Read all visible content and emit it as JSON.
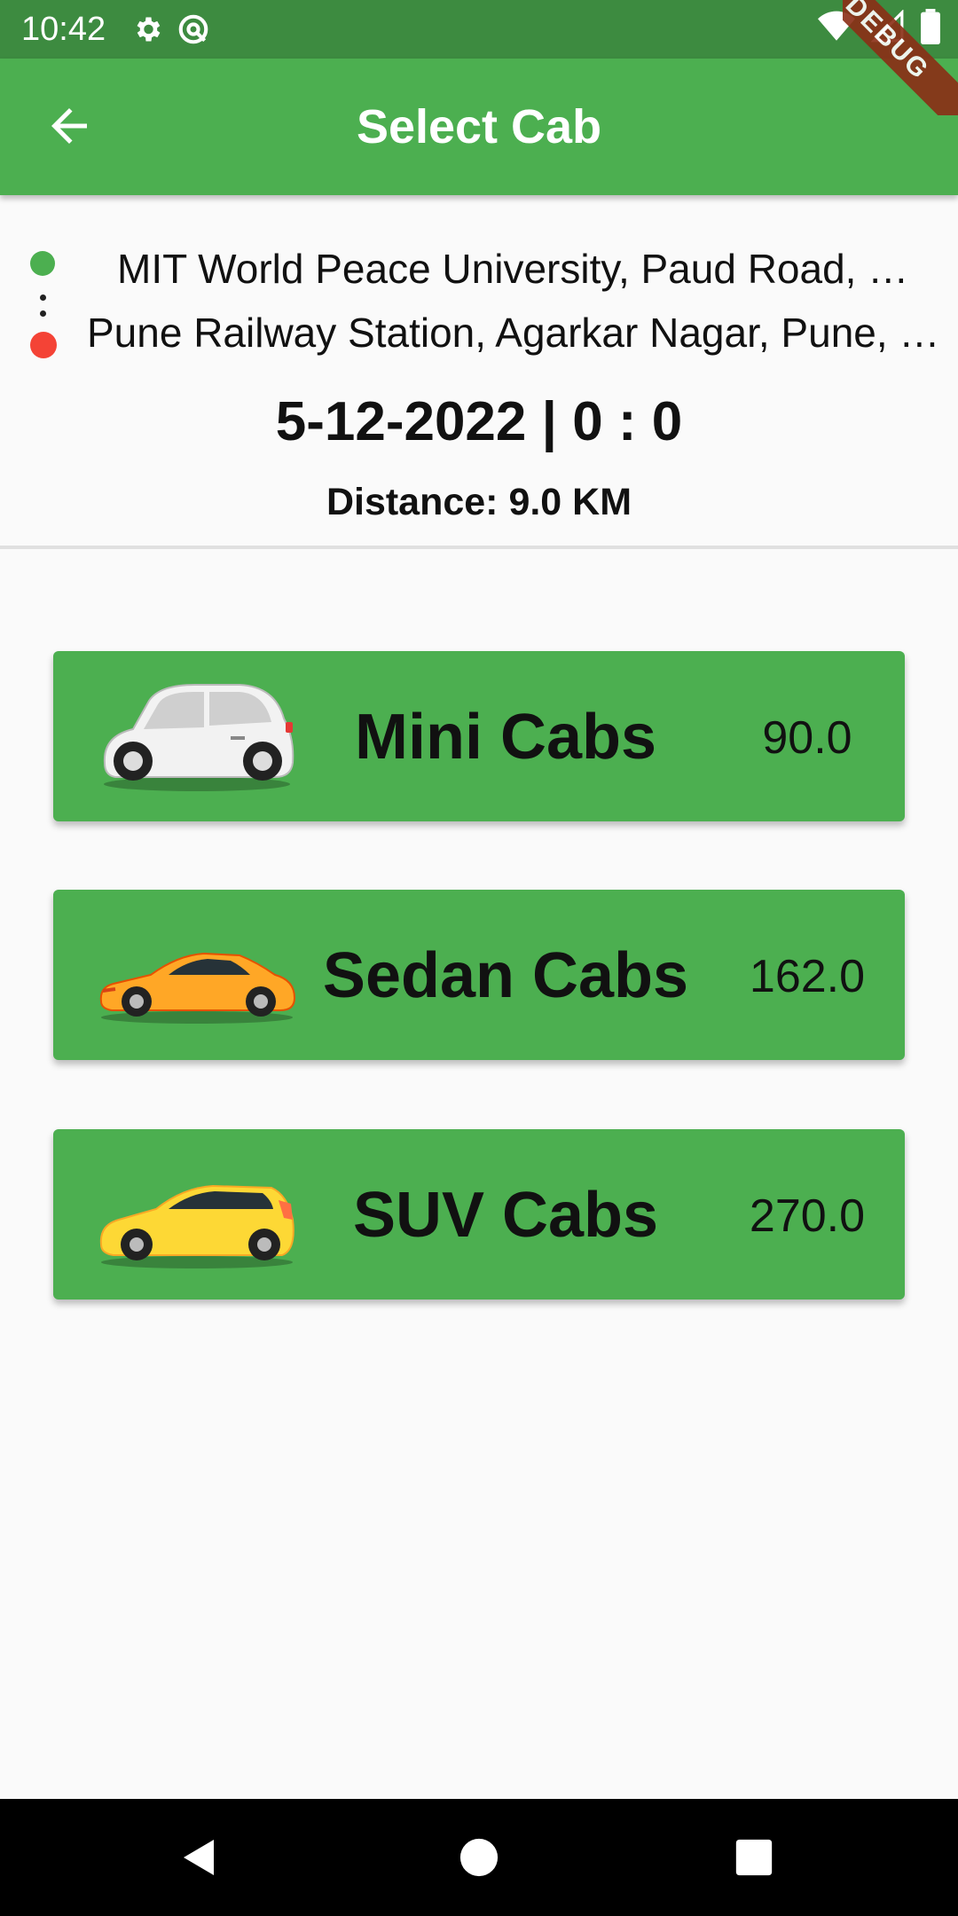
{
  "status_bar": {
    "time": "10:42",
    "icons": [
      "settings-icon",
      "sync-icon",
      "wifi-icon",
      "signal-icon",
      "battery-icon"
    ]
  },
  "debug_banner": "DEBUG",
  "app_bar": {
    "title": "Select Cab",
    "back_icon": "arrow-back-icon"
  },
  "route": {
    "origin": "MIT World Peace University, Paud Road, Kothrud, Pune",
    "destination": "Pune Railway Station, Agarkar Nagar, Pune, Maharashtra"
  },
  "trip": {
    "datetime": "5-12-2022 | 0 : 0",
    "distance": "Distance: 9.0 KM"
  },
  "cabs": [
    {
      "name": "Mini Cabs",
      "price": "90.0",
      "icon": "white-car-icon"
    },
    {
      "name": "Sedan Cabs",
      "price": "162.0",
      "icon": "orange-sports-car-icon"
    },
    {
      "name": "SUV Cabs",
      "price": "270.0",
      "icon": "yellow-hatchback-icon"
    }
  ],
  "colors": {
    "primary": "#4caf50",
    "status_bar": "#3d8b40",
    "origin_dot": "#4caf50",
    "destination_dot": "#f44336"
  },
  "nav_bar": [
    "back-triangle-icon",
    "home-circle-icon",
    "recents-square-icon"
  ]
}
